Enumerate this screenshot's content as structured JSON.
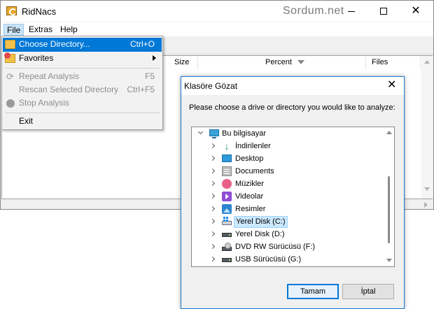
{
  "window": {
    "title": "RidNacs",
    "watermark": "Sordum.net",
    "close_glyph": "✕"
  },
  "menubar": {
    "file": "File",
    "extras": "Extras",
    "help": "Help"
  },
  "file_menu": {
    "items": [
      {
        "label": "Choose Directory...",
        "shortcut": "Ctrl+O",
        "icon": "folder-icon",
        "enabled": true,
        "highlighted": true
      },
      {
        "label": "Favorites",
        "shortcut": "",
        "icon": "favorites-icon",
        "enabled": true,
        "submenu": true
      },
      {
        "label": "Repeat Analysis",
        "shortcut": "F5",
        "icon": "repeat-icon",
        "enabled": false
      },
      {
        "label": "Rescan Selected Directory",
        "shortcut": "Ctrl+F5",
        "icon": "",
        "enabled": false
      },
      {
        "label": "Stop Analysis",
        "shortcut": "",
        "icon": "stop-icon",
        "enabled": false
      },
      {
        "label": "Exit",
        "shortcut": "",
        "icon": "",
        "enabled": true
      }
    ]
  },
  "listview": {
    "columns": [
      "Size",
      "Percent",
      "Files"
    ]
  },
  "dialog": {
    "title": "Klasöre Gözat",
    "close_glyph": "✕",
    "prompt": "Please choose a drive or directory you would like to analyze:",
    "tree": {
      "root": "Bu bilgisayar",
      "children": [
        {
          "label": "İndirilenler",
          "icon": "download-icon"
        },
        {
          "label": "Desktop",
          "icon": "desktop-icon"
        },
        {
          "label": "Documents",
          "icon": "documents-icon"
        },
        {
          "label": "Müzikler",
          "icon": "music-icon"
        },
        {
          "label": "Videolar",
          "icon": "video-icon"
        },
        {
          "label": "Resimler",
          "icon": "pictures-icon"
        },
        {
          "label": "Yerel Disk (C:)",
          "icon": "system-drive-icon",
          "selected": true
        },
        {
          "label": "Yerel Disk (D:)",
          "icon": "drive-icon"
        },
        {
          "label": "DVD RW Sürücüsü (F:)",
          "icon": "dvd-drive-icon"
        },
        {
          "label": "USB Sürücüsü (G:)",
          "icon": "usb-drive-icon"
        }
      ]
    },
    "ok_label": "Tamam",
    "cancel_label": "İptal"
  },
  "colors": {
    "highlight": "#0078d7",
    "dialog_border": "#1c7ad4"
  }
}
